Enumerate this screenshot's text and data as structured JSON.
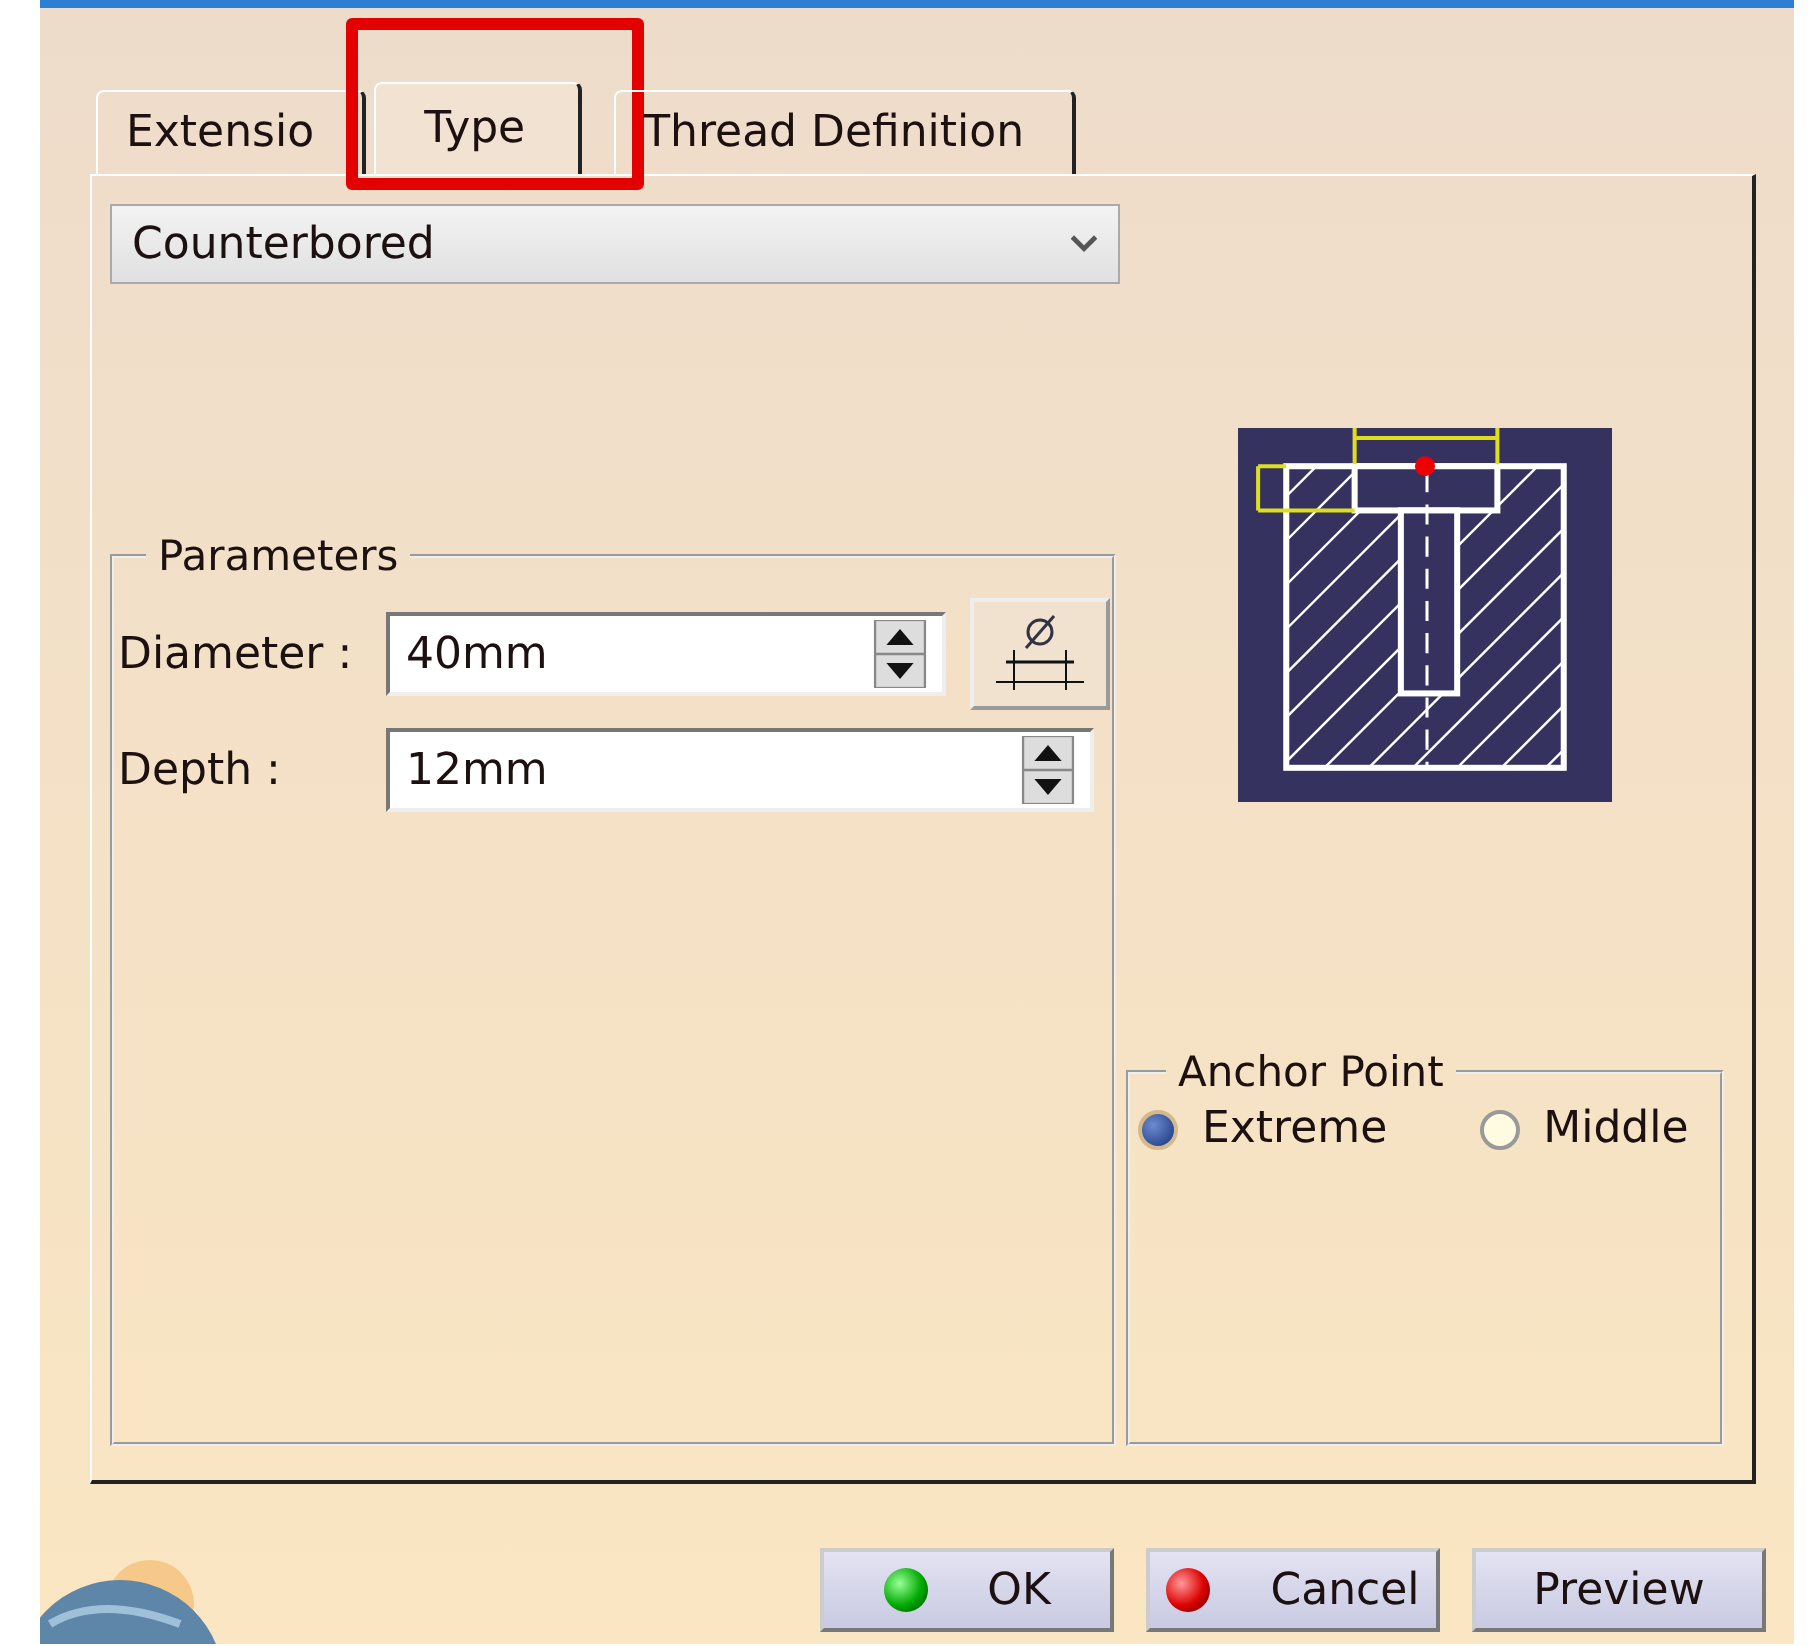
{
  "tabs": [
    {
      "label": "Extensio",
      "selected": false,
      "highlighted": false
    },
    {
      "label": "Type",
      "selected": true,
      "highlighted": true
    },
    {
      "label": "Thread Definition",
      "selected": false,
      "highlighted": false
    }
  ],
  "hole_type": {
    "value": "Counterbored"
  },
  "parameters": {
    "title": "Parameters",
    "fields": [
      {
        "label": "Diameter :",
        "value": "40mm",
        "kind": "with_button"
      },
      {
        "label": "Depth :",
        "value": "12mm",
        "kind": "plain"
      }
    ]
  },
  "anchor_point": {
    "title": "Anchor Point",
    "options": [
      {
        "label": "Extreme",
        "selected": true
      },
      {
        "label": "Middle",
        "selected": false
      }
    ]
  },
  "buttons": [
    {
      "label": "OK",
      "kind": "ok"
    },
    {
      "label": "Cancel",
      "kind": "cancel"
    },
    {
      "label": "Preview",
      "kind": "plain"
    }
  ]
}
